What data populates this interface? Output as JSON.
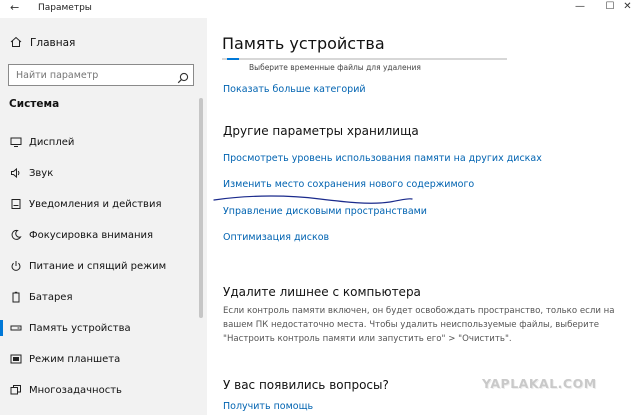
{
  "window": {
    "title": "Параметры",
    "back_glyph": "←",
    "minimize_glyph": "—",
    "maximize_glyph": "☐",
    "close_glyph": "✕"
  },
  "sidebar": {
    "home_label": "Главная",
    "search_placeholder": "Найти параметр",
    "section_title": "Система",
    "items": [
      {
        "label": "Дисплей",
        "icon": "display-icon"
      },
      {
        "label": "Звук",
        "icon": "sound-icon"
      },
      {
        "label": "Уведомления и действия",
        "icon": "notifications-icon"
      },
      {
        "label": "Фокусировка внимания",
        "icon": "focus-assist-icon"
      },
      {
        "label": "Питание и спящий режим",
        "icon": "power-icon"
      },
      {
        "label": "Батарея",
        "icon": "battery-icon"
      },
      {
        "label": "Память устройства",
        "icon": "storage-icon",
        "active": true
      },
      {
        "label": "Режим планшета",
        "icon": "tablet-icon"
      },
      {
        "label": "Многозадачность",
        "icon": "multitasking-icon"
      }
    ]
  },
  "main": {
    "title": "Память устройства",
    "progress_caption": "Выберите временные файлы для удаления",
    "show_more_link": "Показать больше категорий",
    "other_settings_heading": "Другие параметры хранилища",
    "links": [
      "Просмотреть уровень использования памяти на других дисках",
      "Изменить место сохранения нового содержимого",
      "Управление дисковыми пространствами",
      "Оптимизация дисков"
    ],
    "free_up_heading": "Удалите лишнее с компьютера",
    "free_up_text": "Если контроль памяти включен, он будет освобождать пространство, только если на вашем ПК недостаточно места. Чтобы удалить неиспользуемые файлы, выберите \"Настроить контроль памяти или запустить его\" > \"Очистить\".",
    "questions_heading": "У вас появились вопросы?",
    "help_link": "Получить помощь"
  },
  "colors": {
    "accent": "#0078d7",
    "link": "#0063b1",
    "sidebar_bg": "#f2f2f2",
    "pen_stroke": "#1a2a8c"
  },
  "watermark": "YAPLAKAL.COM"
}
